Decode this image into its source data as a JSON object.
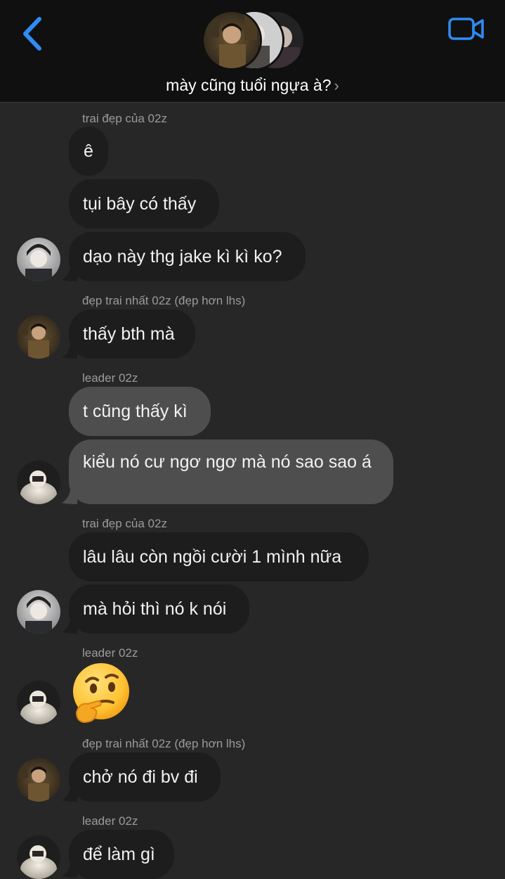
{
  "header": {
    "title": "mày cũng tuổi ngựa à?",
    "chevron": "›",
    "back_icon": "chevron-left-icon",
    "video_icon": "video-camera-icon",
    "accent_color": "#2f8cf6"
  },
  "messages": [
    {
      "sender": "trai đẹp của 02z"
    },
    {
      "text": "ê"
    },
    {
      "text": "tụi bây có thấy"
    },
    {
      "text": "dạo này thg jake kì kì ko?"
    },
    {
      "sender": "đẹp trai nhất 02z (đẹp hơn lhs)"
    },
    {
      "text": "thấy bth mà"
    },
    {
      "sender": "leader 02z"
    },
    {
      "text": "t cũng thấy kì"
    },
    {
      "text": "kiểu nó cư ngơ ngơ mà nó sao sao á"
    },
    {
      "sender": "trai đẹp của 02z"
    },
    {
      "text": "lâu lâu còn ngồi cười 1 mình nữa"
    },
    {
      "text": "mà hỏi thì nó k nói"
    },
    {
      "sender": "leader 02z"
    },
    {
      "emoji": "thinking-face"
    },
    {
      "sender": "đẹp trai nhất 02z (đẹp hơn lhs)"
    },
    {
      "text": "chở nó đi bv đi"
    },
    {
      "sender": "leader 02z"
    },
    {
      "text": "để làm gì"
    }
  ]
}
